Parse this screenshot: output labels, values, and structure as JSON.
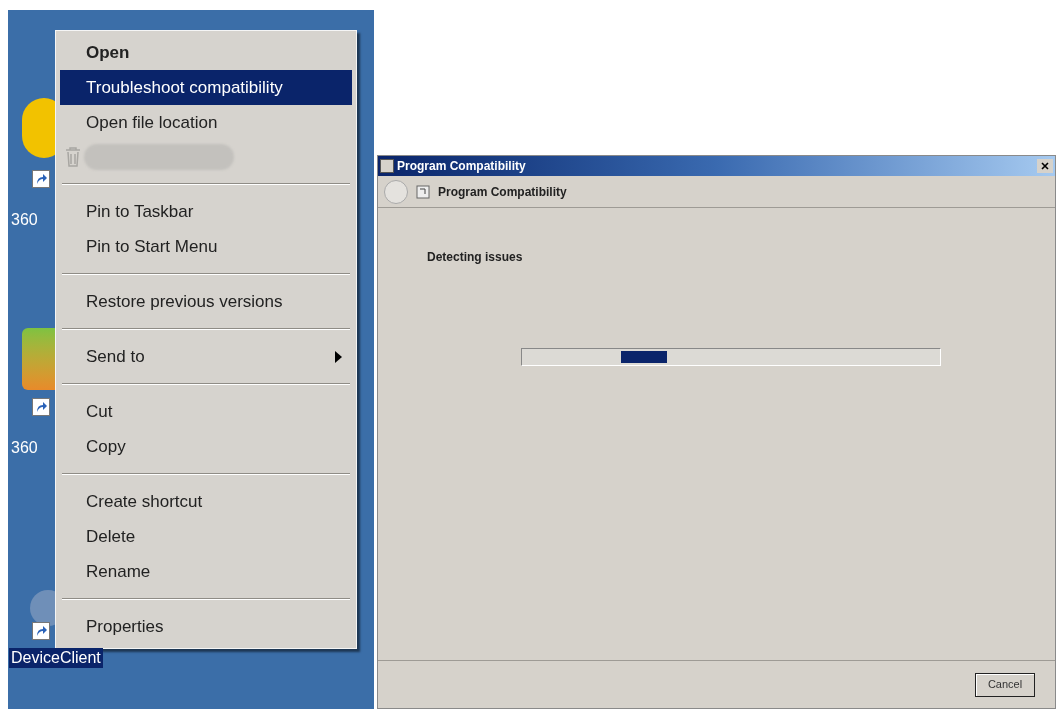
{
  "desktop": {
    "icons": [
      {
        "label": "360",
        "kind": "yellow",
        "selected": false
      },
      {
        "label": "360",
        "kind": "green",
        "selected": false
      },
      {
        "label": "DeviceClient",
        "kind": "plain",
        "selected": true
      }
    ]
  },
  "context_menu": {
    "groups": [
      [
        {
          "label": "Open",
          "default": true,
          "selected": false
        },
        {
          "label": "Troubleshoot compatibility",
          "default": false,
          "selected": true
        },
        {
          "label": "Open file location",
          "default": false,
          "selected": false
        },
        {
          "kind": "redacted"
        }
      ],
      [
        {
          "label": "Pin to Taskbar",
          "default": false,
          "selected": false
        },
        {
          "label": "Pin to Start Menu",
          "default": false,
          "selected": false
        }
      ],
      [
        {
          "label": "Restore previous versions",
          "default": false,
          "selected": false
        }
      ],
      [
        {
          "label": "Send to",
          "default": false,
          "selected": false,
          "submenu": true
        }
      ],
      [
        {
          "label": "Cut",
          "default": false,
          "selected": false
        },
        {
          "label": "Copy",
          "default": false,
          "selected": false
        }
      ],
      [
        {
          "label": "Create shortcut",
          "default": false,
          "selected": false
        },
        {
          "label": "Delete",
          "default": false,
          "selected": false
        },
        {
          "label": "Rename",
          "default": false,
          "selected": false
        }
      ],
      [
        {
          "label": "Properties",
          "default": false,
          "selected": false
        }
      ]
    ]
  },
  "dialog": {
    "title": "Program Compatibility",
    "header": "Program Compatibility",
    "status": "Detecting issues",
    "buttons": [
      "Cancel"
    ]
  }
}
